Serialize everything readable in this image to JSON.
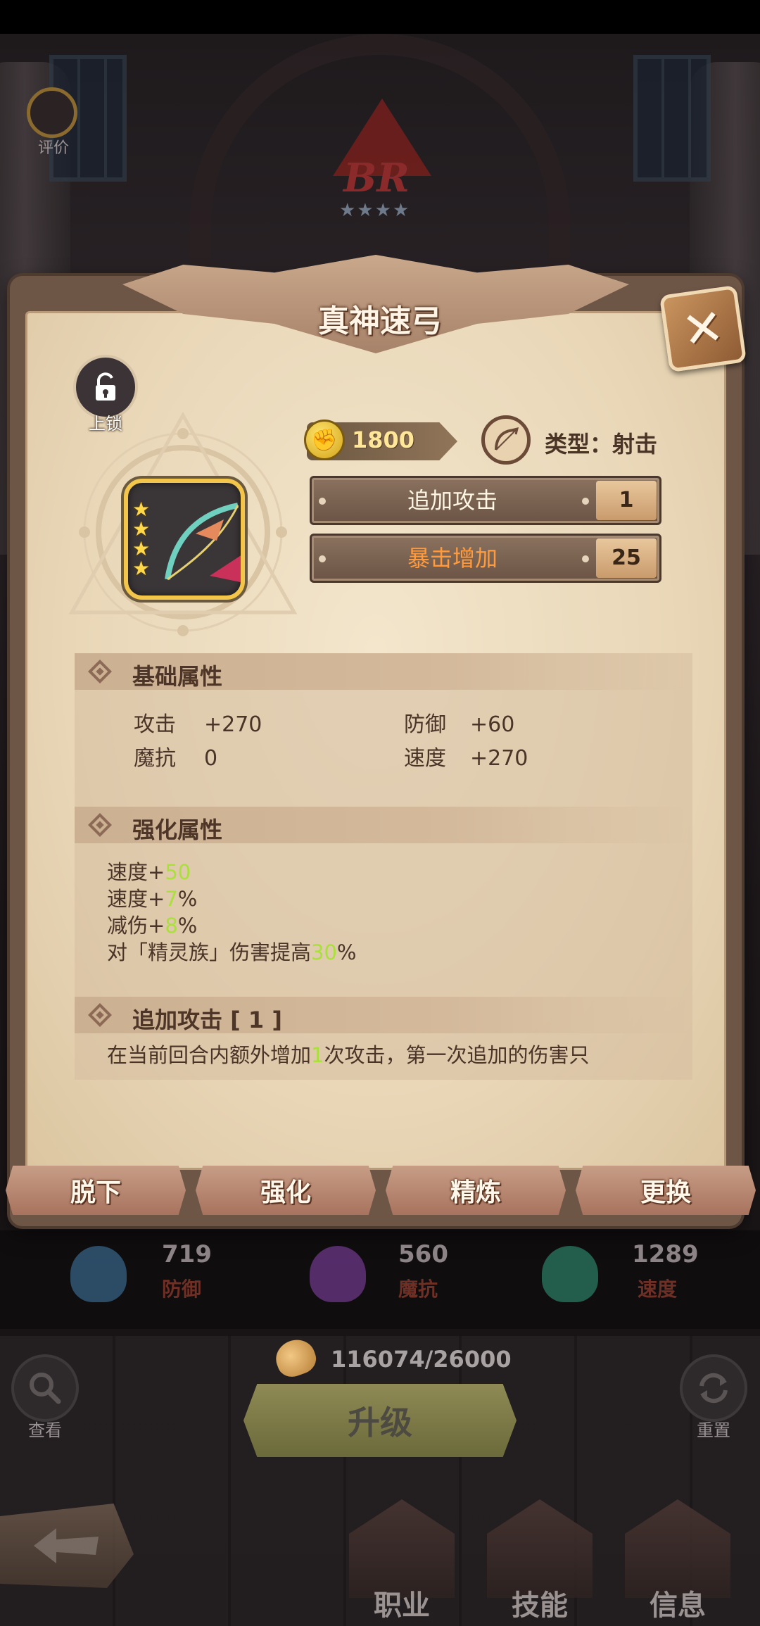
{
  "header": {
    "rating_label": "评价",
    "emblem_text": "BR",
    "emblem_stars": "★★★★"
  },
  "modal": {
    "title": "真神速弓",
    "close_glyph": "✕",
    "lock_label": "上锁",
    "item_stars": [
      "★",
      "★",
      "★",
      "★"
    ],
    "power": "1800",
    "type_label": "类型：射击",
    "stats": [
      {
        "name": "追加攻击",
        "value": "1"
      },
      {
        "name": "暴击增加",
        "value": "25"
      }
    ],
    "base_section": {
      "title": "基础属性",
      "rows": [
        {
          "key": "攻击",
          "value": "+270"
        },
        {
          "key": "防御",
          "value": "+60"
        },
        {
          "key": "魔抗",
          "value": "0"
        },
        {
          "key": "速度",
          "value": "+270"
        }
      ]
    },
    "enhance_section": {
      "title": "强化属性",
      "lines": [
        {
          "prefix": "速度+",
          "highlight": "50",
          "suffix": ""
        },
        {
          "prefix": "速度+",
          "highlight": "7",
          "suffix": "%"
        },
        {
          "prefix": "减伤+",
          "highlight": "8",
          "suffix": "%"
        },
        {
          "prefix": "对「精灵族」伤害提高",
          "highlight": "30",
          "suffix": "%"
        }
      ]
    },
    "extra_section": {
      "title": "追加攻击 [ 1 ]",
      "desc_prefix": "在当前回合内额外增加",
      "desc_highlight": "1",
      "desc_suffix": "次攻击，第一次追加的伤害只"
    },
    "actions": [
      "脱下",
      "强化",
      "精炼",
      "更换"
    ]
  },
  "background_stats": [
    {
      "value": "719",
      "label": "防御",
      "color": "#3c6f97"
    },
    {
      "value": "560",
      "label": "魔抗",
      "color": "#7a3e9a"
    },
    {
      "value": "1289",
      "label": "速度",
      "color": "#2e8a6e"
    }
  ],
  "currency": "116074/26000",
  "upgrade_label": "升级",
  "search_label": "查看",
  "reset_label": "重置",
  "nav": [
    "职业",
    "技能",
    "信息"
  ],
  "colors": {
    "highlight": "#a9e039",
    "crit_text": "#ff9a3d",
    "frame_gold": "#f3c54b"
  }
}
